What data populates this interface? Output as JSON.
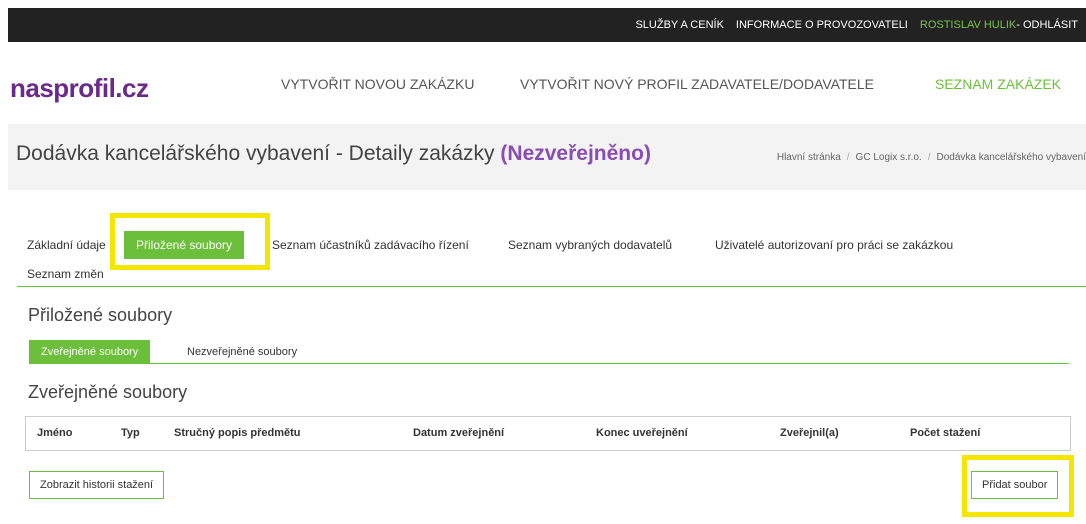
{
  "topbar": {
    "services": "SLUŽBY A CENÍK",
    "operator_info": "INFORMACE O PROVOZOVATELI",
    "user": "ROSTISLAV HULIK",
    "logout": " - ODHLÁSIT"
  },
  "logo": {
    "name": "nasprofil",
    "tld": ".cz"
  },
  "nav": {
    "new_order": "VYTVOŘIT NOVOU ZAKÁZKU",
    "new_profile": "VYTVOŘIT NOVÝ PROFIL ZADAVATELE/DODAVATELE",
    "order_list": "SEZNAM ZAKÁZEK"
  },
  "title": {
    "main": "Dodávka kancelářského vybavení - Detaily zakázky ",
    "status": "(Nezveřejněno)"
  },
  "breadcrumb": [
    "Hlavní stránka",
    "GC Logix s.r.o.",
    "Dodávka kancelářského vybavení"
  ],
  "tabs": [
    {
      "label": "Základní údaje"
    },
    {
      "label": "Přiložené soubory"
    },
    {
      "label": "Seznam účastníků zadávacího řízení"
    },
    {
      "label": "Seznam vybraných dodavatelů"
    },
    {
      "label": "Uživatelé autorizovaní pro práci se zakázkou"
    },
    {
      "label": "Seznam změn"
    }
  ],
  "attached_heading": "Přiložené soubory",
  "subtabs": [
    {
      "label": "Zveřejněné soubory"
    },
    {
      "label": "Nezveřejněné soubory"
    }
  ],
  "published_heading": "Zveřejněné soubory",
  "table": {
    "columns": [
      "Jméno",
      "Typ",
      "Stručný popis předmětu",
      "Datum zveřejnění",
      "Konec uveřejnění",
      "Zveřejnil(a)",
      "Počet stažení"
    ]
  },
  "buttons": {
    "history": "Zobrazit historii stažení",
    "add_file": "Přidat soubor"
  },
  "colors": {
    "accent_green": "#6cbf3a",
    "brand_purple": "#6b2a8a",
    "highlight_yellow": "#f5e600",
    "topbar": "#222222"
  }
}
